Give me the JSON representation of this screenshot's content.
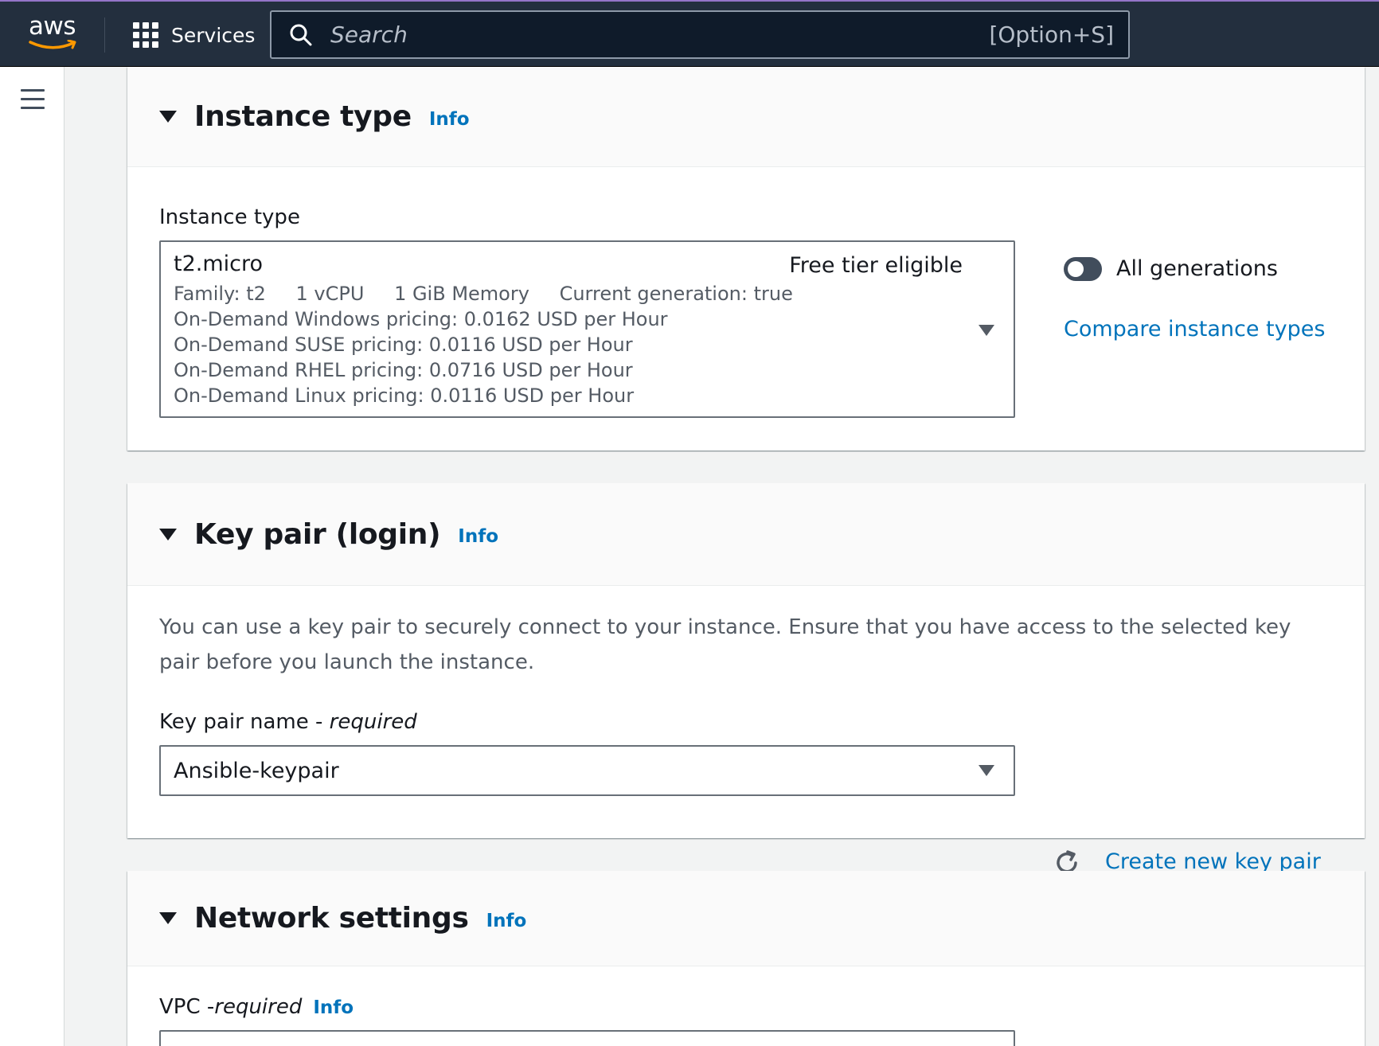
{
  "topnav": {
    "logo_text": "aws",
    "services_label": "Services",
    "search_placeholder": "Search",
    "search_shortcut": "[Option+S]"
  },
  "instance_type_section": {
    "title": "Instance type",
    "info": "Info",
    "field_label": "Instance type",
    "selected": {
      "name": "t2.micro",
      "badge": "Free tier eligible",
      "family": "Family: t2",
      "vcpu": "1 vCPU",
      "memory": "1 GiB Memory",
      "generation": "Current generation: true",
      "pricing": [
        "On-Demand Windows pricing: 0.0162 USD per Hour",
        "On-Demand SUSE pricing: 0.0116 USD per Hour",
        "On-Demand RHEL pricing: 0.0716 USD per Hour",
        "On-Demand Linux pricing: 0.0116 USD per Hour"
      ]
    },
    "toggle_label": "All generations",
    "toggle_on": false,
    "compare_link": "Compare instance types"
  },
  "key_pair_section": {
    "title": "Key pair (login)",
    "info": "Info",
    "description": "You can use a key pair to securely connect to your instance. Ensure that you have access to the selected key pair before you launch the instance.",
    "field_label": "Key pair name - ",
    "field_required": "required",
    "selected": "Ansible-keypair",
    "create_link": "Create new key pair"
  },
  "network_section": {
    "title": "Network settings",
    "info": "Info",
    "vpc_label": "VPC - ",
    "vpc_required": "required",
    "vpc_info": "Info"
  },
  "colors": {
    "nav_bg": "#232f3e",
    "link": "#0073bb",
    "page_bg": "#f2f3f3"
  }
}
